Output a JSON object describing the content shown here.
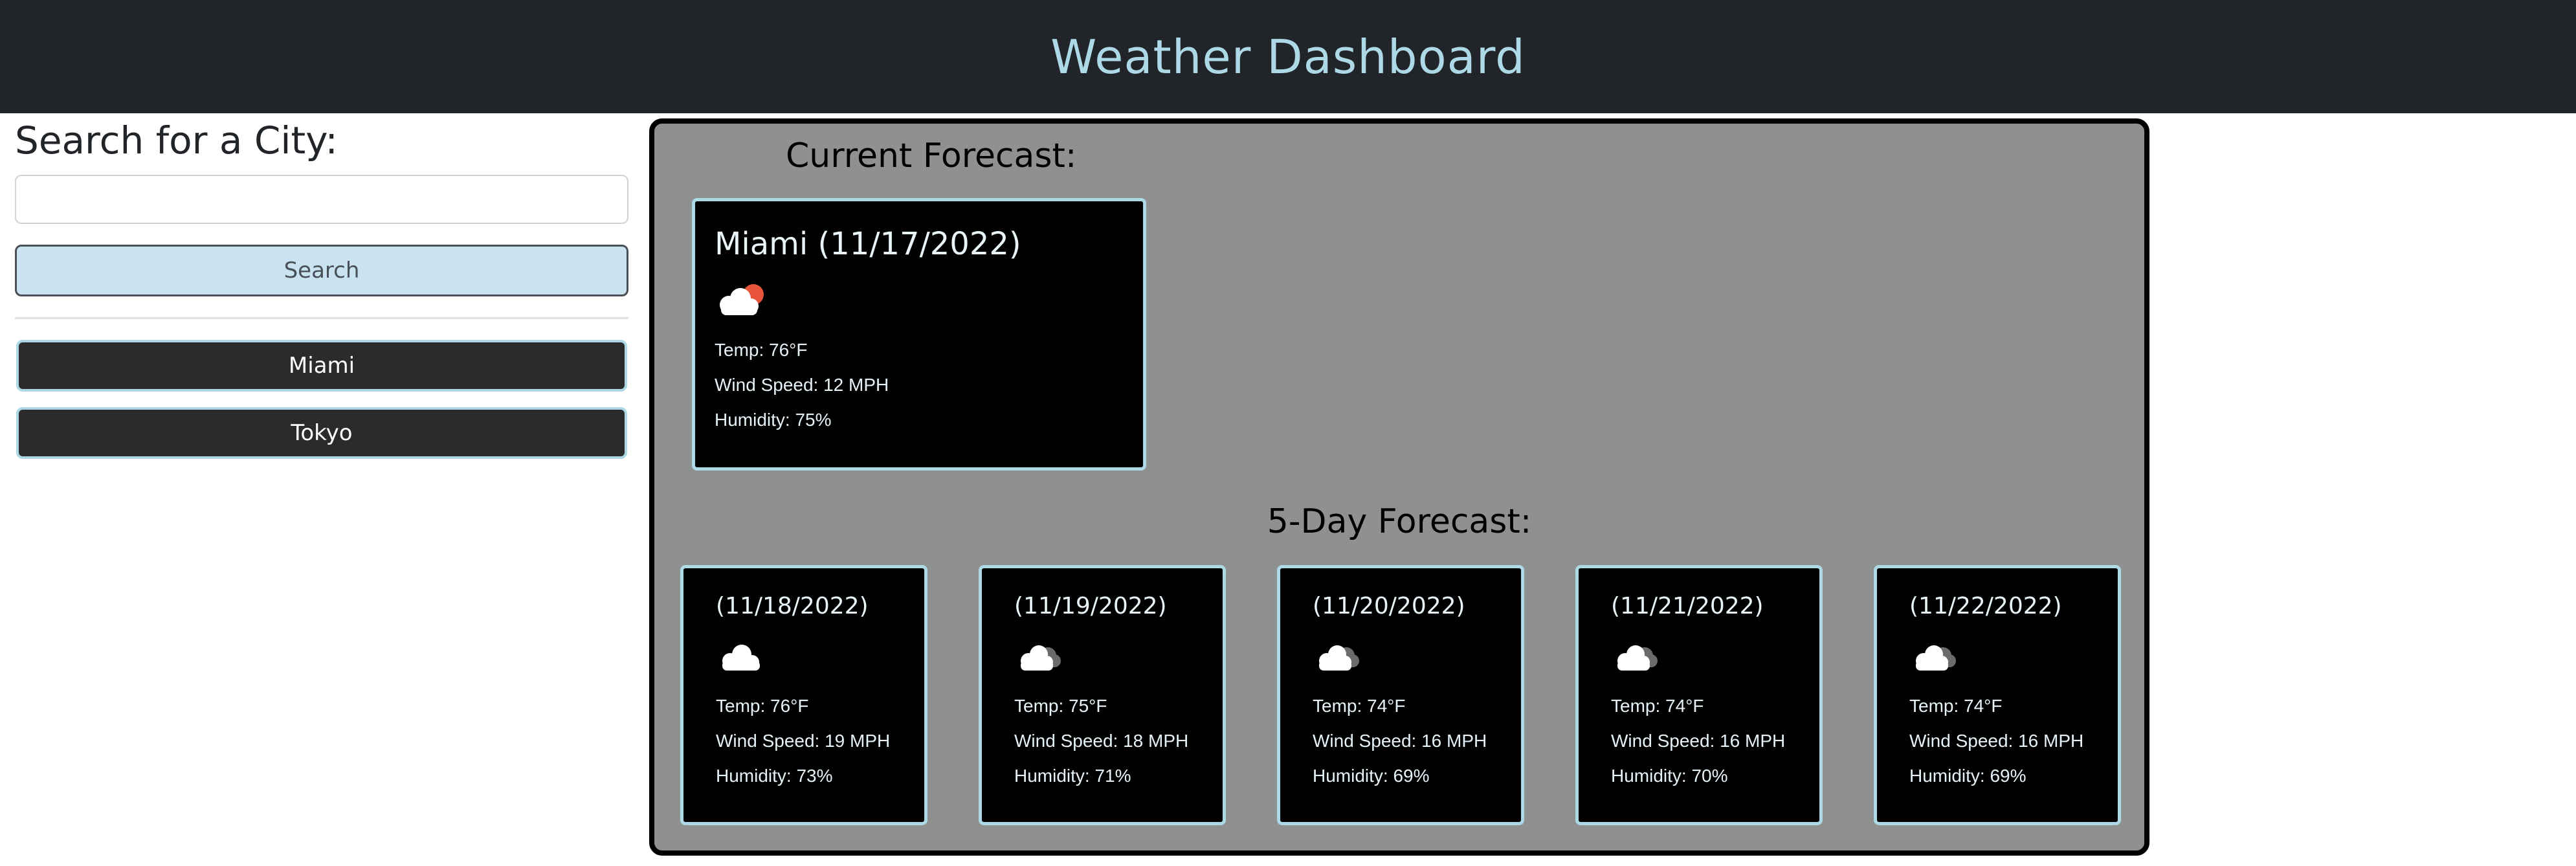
{
  "header": {
    "title": "Weather Dashboard"
  },
  "sidebar": {
    "search_title": "Search for a City:",
    "search_input_value": "",
    "search_button_label": "Search",
    "history": [
      {
        "label": "Miami"
      },
      {
        "label": "Tokyo"
      }
    ]
  },
  "current": {
    "section_title": "Current Forecast:",
    "city_date": "Miami (11/17/2022)",
    "icon": "partly-cloudy-sun-icon",
    "temp": "Temp: 76°F",
    "wind": "Wind Speed: 12 MPH",
    "humidity": "Humidity: 75%"
  },
  "forecast": {
    "section_title": "5-Day Forecast:",
    "days": [
      {
        "date": "(11/18/2022)",
        "icon": "cloud-icon",
        "temp": "Temp: 76°F",
        "wind": "Wind Speed: 19 MPH",
        "humidity": "Humidity: 73%"
      },
      {
        "date": "(11/19/2022)",
        "icon": "overcast-clouds-icon",
        "temp": "Temp: 75°F",
        "wind": "Wind Speed: 18 MPH",
        "humidity": "Humidity: 71%"
      },
      {
        "date": "(11/20/2022)",
        "icon": "overcast-clouds-icon",
        "temp": "Temp: 74°F",
        "wind": "Wind Speed: 16 MPH",
        "humidity": "Humidity: 69%"
      },
      {
        "date": "(11/21/2022)",
        "icon": "overcast-clouds-icon",
        "temp": "Temp: 74°F",
        "wind": "Wind Speed: 16 MPH",
        "humidity": "Humidity: 70%"
      },
      {
        "date": "(11/22/2022)",
        "icon": "overcast-clouds-icon",
        "temp": "Temp: 74°F",
        "wind": "Wind Speed: 16 MPH",
        "humidity": "Humidity: 69%"
      }
    ]
  },
  "colors": {
    "header_bg": "#212529",
    "accent": "#add8e6",
    "panel_bg": "#8e9190",
    "card_bg": "#000000",
    "search_button_bg": "#c9e4f0",
    "city_button_bg": "#2b2b2b",
    "sun": "#e8553a"
  }
}
